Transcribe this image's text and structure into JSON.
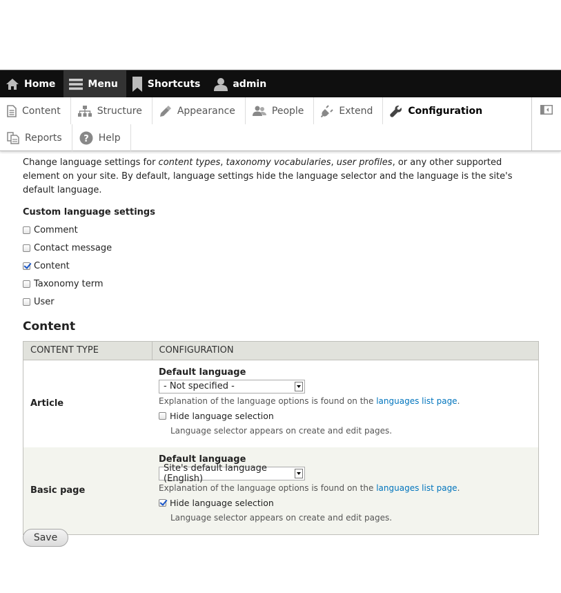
{
  "toolbar": {
    "items": [
      {
        "label": "Home",
        "icon": "home-icon"
      },
      {
        "label": "Menu",
        "icon": "menu-icon"
      },
      {
        "label": "Shortcuts",
        "icon": "bookmark-icon"
      },
      {
        "label": "admin",
        "icon": "user-icon"
      }
    ]
  },
  "tray": {
    "items": [
      {
        "label": "Content",
        "icon": "document-icon"
      },
      {
        "label": "Structure",
        "icon": "sitemap-icon"
      },
      {
        "label": "Appearance",
        "icon": "paintbrush-icon"
      },
      {
        "label": "People",
        "icon": "people-icon"
      },
      {
        "label": "Extend",
        "icon": "plug-icon"
      },
      {
        "label": "Configuration",
        "icon": "wrench-icon"
      },
      {
        "label": "Reports",
        "icon": "reports-icon"
      },
      {
        "label": "Help",
        "icon": "help-icon"
      }
    ]
  },
  "intro": {
    "part1": "Change language settings for ",
    "em1": "content types",
    "sep1": ", ",
    "em2": "taxonomy vocabularies",
    "sep2": ", ",
    "em3": "user profiles",
    "part2": ", or any other supported element on your site. By default, language settings hide the language selector and the language is the site's default language."
  },
  "custom_settings": {
    "label": "Custom language settings",
    "options": [
      {
        "label": "Comment",
        "checked": false
      },
      {
        "label": "Contact message",
        "checked": false
      },
      {
        "label": "Content",
        "checked": true
      },
      {
        "label": "Taxonomy term",
        "checked": false
      },
      {
        "label": "User",
        "checked": false
      }
    ]
  },
  "content_section": {
    "heading": "Content",
    "columns": [
      "CONTENT TYPE",
      "CONFIGURATION"
    ],
    "rows": [
      {
        "type": "Article",
        "default_language_label": "Default language",
        "selected": "- Not specified -",
        "explanation_prefix": "Explanation of the language options is found on the ",
        "explanation_link": "languages list page",
        "explanation_suffix": ".",
        "hide_label": "Hide language selection",
        "hide_checked": false,
        "hide_description": "Language selector appears on create and edit pages."
      },
      {
        "type": "Basic page",
        "default_language_label": "Default language",
        "selected": "Site's default language (English)",
        "explanation_prefix": "Explanation of the language options is found on the ",
        "explanation_link": "languages list page",
        "explanation_suffix": ".",
        "hide_label": "Hide language selection",
        "hide_checked": true,
        "hide_description": "Language selector appears on create and edit pages."
      }
    ]
  },
  "save_label": "Save"
}
